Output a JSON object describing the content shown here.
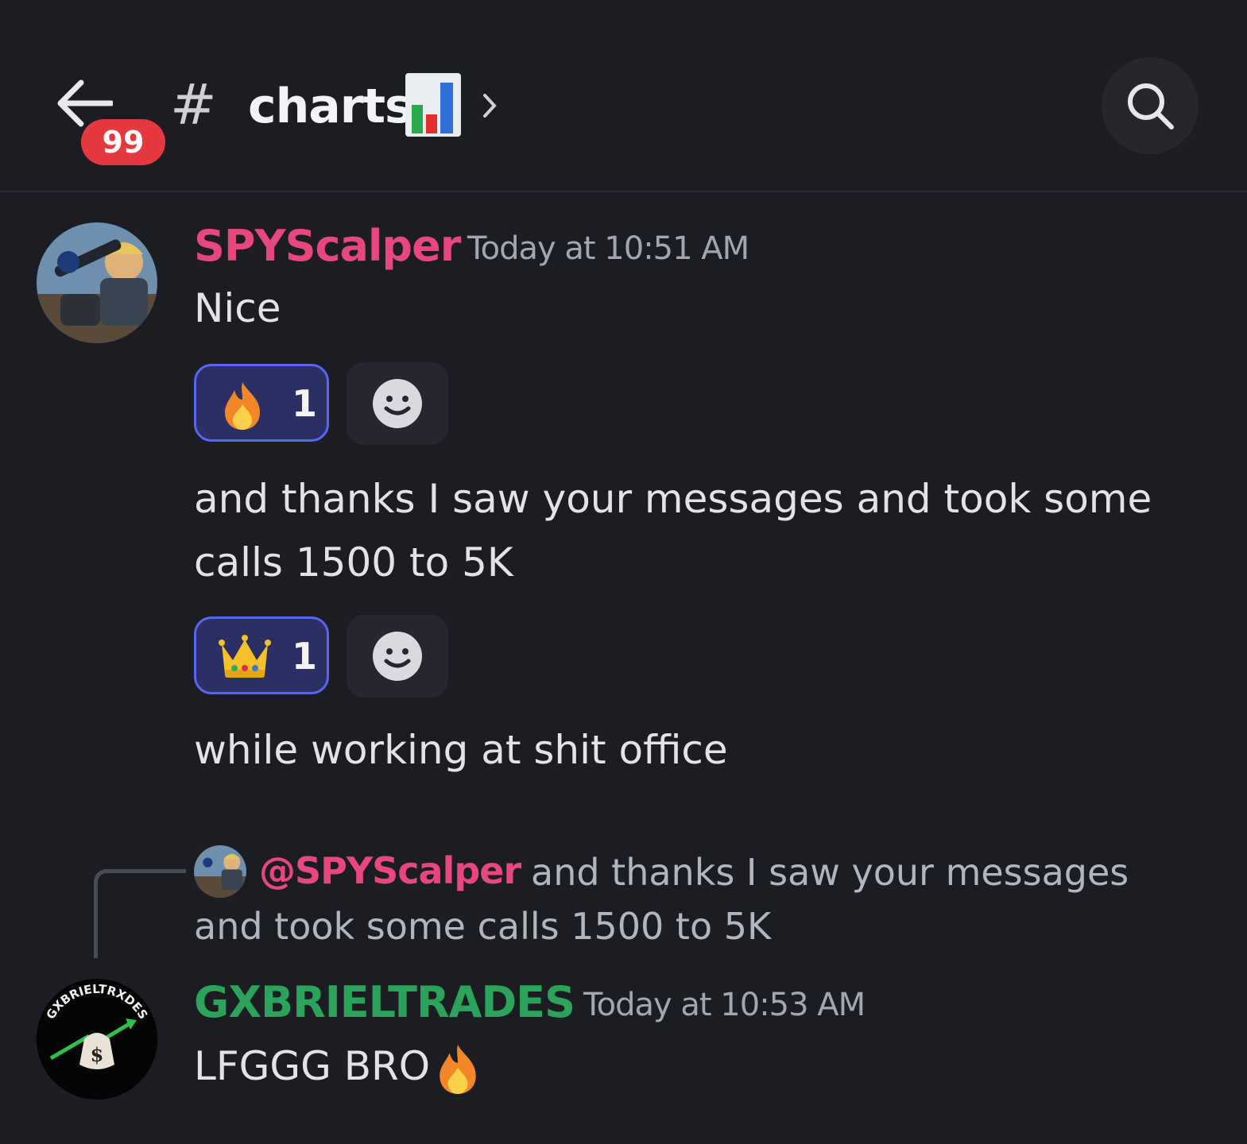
{
  "header": {
    "back_icon": "arrow-left-icon",
    "unread_badge": "99",
    "hash_symbol": "#",
    "channel_name": "charts",
    "channel_emoji": "bar-chart-emoji",
    "chevron_icon": "chevron-right-icon",
    "search_icon": "search-icon"
  },
  "messages": [
    {
      "author": "SPYScalper",
      "author_color": "#e7477c",
      "timestamp": "Today at 10:51 AM",
      "lines": [
        {
          "text": "Nice",
          "reaction": {
            "emoji": "fire-emoji",
            "count": "1"
          }
        },
        {
          "text": "and thanks I saw your messages and took some calls 1500 to 5K",
          "reaction": {
            "emoji": "crown-emoji",
            "count": "1"
          }
        },
        {
          "text": "while working at shit office"
        }
      ]
    },
    {
      "reply_to": {
        "mention": "@SPYScalper",
        "text": "and thanks I saw your messages and took some calls 1500 to 5K"
      },
      "author": "GXBRIELTRADES",
      "author_color": "#2ba35a",
      "timestamp": "Today at 10:53 AM",
      "text": "LFGGG BRO",
      "text_emoji": "fire-emoji",
      "avatar_text": "GXBRIELTRXDES"
    }
  ],
  "colors": {
    "background": "#1c1d23",
    "reaction_border": "#5865f2",
    "badge": "#e5393f"
  }
}
